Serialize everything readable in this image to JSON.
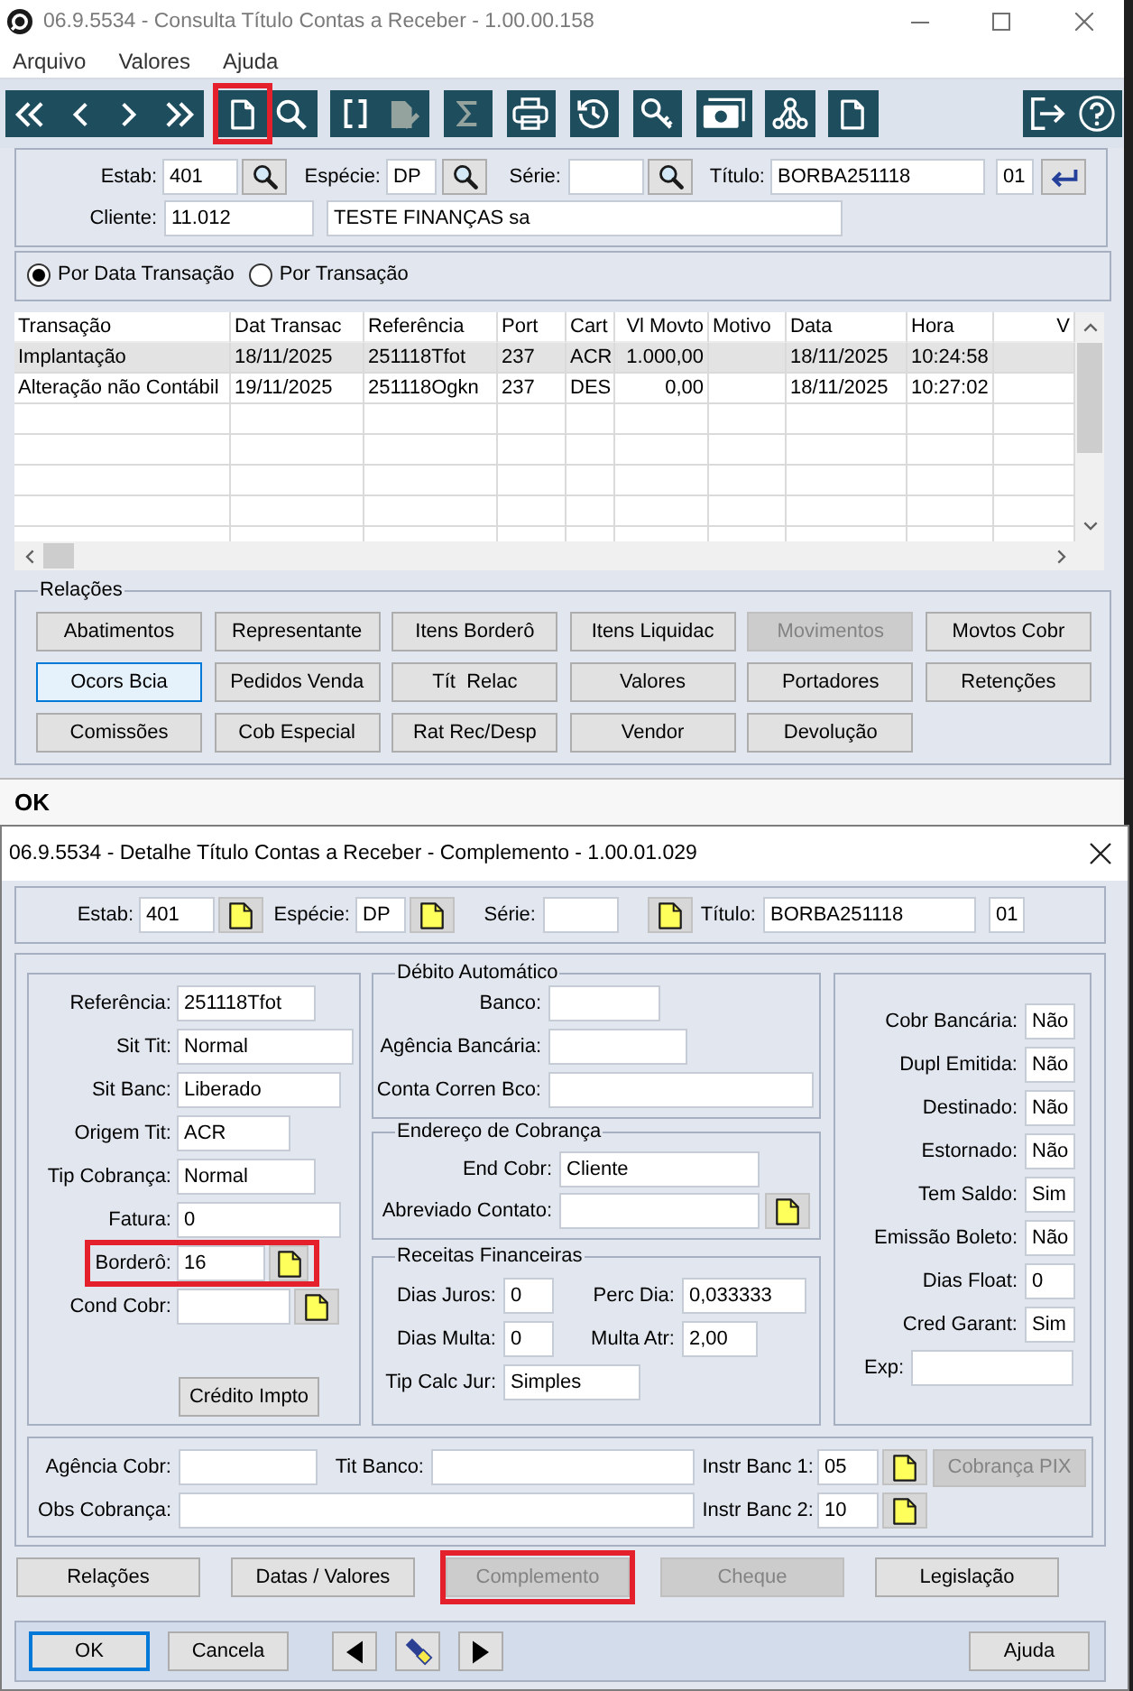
{
  "window": {
    "title": "06.9.5534 - Consulta Título Contas a Receber - 1.00.00.158"
  },
  "menu": [
    {
      "label": "Arquivo"
    },
    {
      "label": "Valores"
    },
    {
      "label": "Ajuda"
    }
  ],
  "toolbar": {
    "groups": [
      [
        {
          "kind": "first",
          "disabled": false,
          "highlighted": false
        },
        {
          "kind": "previous",
          "disabled": false,
          "highlighted": false
        },
        {
          "kind": "next",
          "disabled": false,
          "highlighted": false
        },
        {
          "kind": "last",
          "disabled": false,
          "highlighted": false
        }
      ],
      [
        {
          "kind": "new",
          "disabled": false,
          "highlighted": true
        },
        {
          "kind": "search",
          "disabled": false,
          "highlighted": false
        }
      ],
      [
        {
          "kind": "brackets",
          "disabled": false,
          "highlighted": false
        },
        {
          "kind": "edit",
          "disabled": true,
          "highlighted": false
        }
      ],
      [
        {
          "kind": "sum",
          "disabled": true,
          "highlighted": false
        }
      ],
      [
        {
          "kind": "print",
          "disabled": false,
          "highlighted": false
        }
      ],
      [
        {
          "kind": "history",
          "disabled": false,
          "highlighted": false
        }
      ],
      [
        {
          "kind": "key",
          "disabled": false,
          "highlighted": false
        }
      ],
      [
        {
          "kind": "money",
          "disabled": false,
          "highlighted": false
        }
      ],
      [
        {
          "kind": "tree",
          "disabled": false,
          "highlighted": false
        }
      ],
      [
        {
          "kind": "document",
          "disabled": false,
          "highlighted": false
        }
      ]
    ],
    "right": [
      [
        {
          "kind": "exit",
          "disabled": false,
          "highlighted": false
        },
        {
          "kind": "help",
          "disabled": false,
          "highlighted": false
        }
      ]
    ]
  },
  "query": {
    "rows": [
      [
        {
          "label": "Estab:",
          "value": "401",
          "lookup": true
        },
        {
          "label": "Espécie:",
          "value": "DP",
          "lookup": true
        },
        {
          "label": "Série:",
          "lookup": true
        },
        {
          "label": "Título:",
          "value": "BORBA251118"
        },
        {
          "value": "01"
        }
      ],
      [
        {
          "label": "Cliente:",
          "value": "11.012"
        },
        {
          "value": "TESTE FINANÇAS sa"
        }
      ]
    ]
  },
  "view_options": [
    {
      "label": "Por Data Transação",
      "selected": true
    },
    {
      "label": "Por Transação",
      "selected": false
    }
  ],
  "grid": {
    "columns": [
      "Transação",
      "Dat Transac",
      "Referência",
      "Port",
      "Cart",
      "Vl Movto",
      "Motivo",
      "Data",
      "Hora",
      "V"
    ],
    "rows": [
      {
        "selected": true,
        "cells": [
          "Implantação",
          "18/11/2025",
          "251118Tfot",
          "237",
          "ACR",
          "1.000,00",
          null,
          "18/11/2025",
          "10:24:58",
          null
        ]
      },
      {
        "selected": false,
        "cells": [
          "Alteração não Contábil",
          "19/11/2025",
          "251118Ogkn",
          "237",
          "DES",
          "0,00",
          null,
          "18/11/2025",
          "10:27:02",
          null
        ]
      }
    ]
  },
  "relations": {
    "title": "Relações",
    "buttons": [
      {
        "label": "Abatimentos",
        "disabled": false,
        "focused": false
      },
      {
        "label": "Representante",
        "disabled": false,
        "focused": false
      },
      {
        "label": "Itens Borderô",
        "disabled": false,
        "focused": false
      },
      {
        "label": "Itens Liquidac",
        "disabled": false,
        "focused": false
      },
      {
        "label": "Movimentos",
        "disabled": true,
        "focused": false
      },
      {
        "label": "Movtos Cobr",
        "disabled": false,
        "focused": false
      },
      {
        "label": "Ocors Bcia",
        "disabled": false,
        "focused": true
      },
      {
        "label": "Pedidos Venda",
        "disabled": false,
        "focused": false
      },
      {
        "label": "Tít  Relac",
        "disabled": false,
        "focused": false
      },
      {
        "label": "Valores",
        "disabled": false,
        "focused": false
      },
      {
        "label": "Portadores",
        "disabled": false,
        "focused": false
      },
      {
        "label": "Retenções",
        "disabled": false,
        "focused": false
      },
      {
        "label": "Comissões",
        "disabled": false,
        "focused": false
      },
      {
        "label": "Cob Especial",
        "disabled": false,
        "focused": false
      },
      {
        "label": "Rat Rec/Desp",
        "disabled": false,
        "focused": false
      },
      {
        "label": "Vendor",
        "disabled": false,
        "focused": false
      },
      {
        "label": "Devolução",
        "disabled": false,
        "focused": false
      }
    ]
  },
  "status": {
    "text": "OK"
  },
  "dialog": {
    "title": "06.9.5534 - Detalhe Título Contas a Receber - Complemento - 1.00.01.029",
    "header": {
      "fields": [
        {
          "label": "Estab:",
          "value": "401",
          "lookup": true
        },
        {
          "label": "Espécie:",
          "value": "DP",
          "lookup": true
        },
        {
          "label": "Série:",
          "lookup": true
        },
        {
          "label": "Título:",
          "value": "BORBA251118"
        },
        {
          "value": "01"
        }
      ]
    },
    "situacao": {
      "fields": [
        {
          "label": "Referência:",
          "value": "251118Tfot",
          "highlighted": false
        },
        {
          "label": "Sit Tit:",
          "value": "Normal",
          "highlighted": false
        },
        {
          "label": "Sit Banc:",
          "value": "Liberado",
          "highlighted": false
        },
        {
          "label": "Origem Tit:",
          "value": "ACR",
          "highlighted": false
        },
        {
          "label": "Tip Cobrança:",
          "value": "Normal",
          "highlighted": false
        },
        {
          "label": "Fatura:",
          "value": "0",
          "highlighted": false
        },
        {
          "label": "Borderô:",
          "value": "16",
          "lookup": true,
          "highlighted": true
        },
        {
          "label": "Cond Cobr:",
          "lookup": true,
          "highlighted": false
        }
      ],
      "button": {
        "label": "Crédito Impto"
      }
    },
    "debito": {
      "title": "Débito Automático",
      "fields": [
        {
          "label": "Banco:"
        },
        {
          "label": "Agência Bancária:"
        },
        {
          "label": "Conta Corren Bco:"
        }
      ]
    },
    "endereco": {
      "title": "Endereço de Cobrança",
      "fields": [
        {
          "label": "End Cobr:",
          "value": "Cliente"
        },
        {
          "label": "Abreviado Contato:",
          "lookup": true
        }
      ]
    },
    "receitas": {
      "title": "Receitas Financeiras",
      "rows": [
        [
          {
            "label": "Dias Juros:",
            "value": "0"
          },
          {
            "label": "Perc Dia:",
            "value": "0,033333"
          }
        ],
        [
          {
            "label": "Dias Multa:",
            "value": "0"
          },
          {
            "label": "Multa Atr:",
            "value": "2,00"
          }
        ],
        [
          {
            "label": "Tip Calc Jur:",
            "value": "Simples"
          }
        ]
      ]
    },
    "indicadores": {
      "fields": [
        {
          "label": "Cobr Bancária:",
          "value": "Não"
        },
        {
          "label": "Dupl Emitida:",
          "value": "Não"
        },
        {
          "label": "Destinado:",
          "value": "Não"
        },
        {
          "label": "Estornado:",
          "value": "Não"
        },
        {
          "label": "Tem Saldo:",
          "value": "Sim"
        },
        {
          "label": "Emissão Boleto:",
          "value": "Não"
        },
        {
          "label": "Dias Float:",
          "value": "0"
        },
        {
          "label": "Cred Garant:",
          "value": "Sim"
        },
        {
          "label": "Exp:"
        }
      ]
    },
    "cobranca": {
      "fields": [
        {
          "label": "Agência Cobr:"
        },
        {
          "label": "Tit Banco:"
        },
        {
          "label": "Instr Banc 1:",
          "value": "05",
          "lookup": true
        },
        {
          "label": "Obs Cobrança:"
        },
        {
          "label": "Instr Banc 2:",
          "value": "10",
          "lookup": true
        }
      ],
      "pix_button": {
        "label": "Cobrança PIX",
        "disabled": true
      }
    },
    "sections": [
      {
        "label": "Relações",
        "disabled": false,
        "highlighted": false
      },
      {
        "label": "Datas / Valores",
        "disabled": false,
        "highlighted": false
      },
      {
        "label": "Complemento",
        "disabled": true,
        "highlighted": true
      },
      {
        "label": "Cheque",
        "disabled": true,
        "highlighted": false
      },
      {
        "label": "Legislação",
        "disabled": false,
        "highlighted": false
      }
    ],
    "footer": [
      {
        "kind": "text",
        "label": "OK",
        "focused": true
      },
      {
        "kind": "text",
        "label": "Cancela",
        "focused": false
      },
      {
        "kind": "previous",
        "focused": false
      },
      {
        "kind": "flashlight",
        "focused": false
      },
      {
        "kind": "next",
        "focused": false
      },
      {
        "kind": "text",
        "label": "Ajuda",
        "focused": false
      }
    ]
  }
}
